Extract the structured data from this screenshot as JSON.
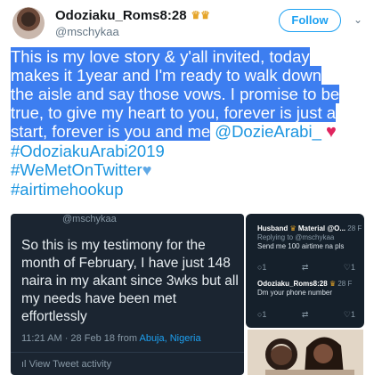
{
  "author": {
    "name": "Odoziaku_Roms8:28",
    "handle": "@mschykaa",
    "badge_icon": "crown-icon"
  },
  "follow_button": {
    "label": "Follow"
  },
  "tweet": {
    "lines": [
      "This is my love story & y'all invited, today",
      "makes it 1year and I'm ready to walk down",
      "the aisle and say those vows. I promise to be",
      "true, to give my heart to you, forever is just a",
      "start, forever is you and me"
    ],
    "mention": "@DozieArabi_",
    "hashtags": [
      "#OdoziakuArabi2019",
      "#WeMetOnTwitter",
      "#airtimehookup"
    ],
    "highlight_color": "#3d7ef0",
    "link_color": "#1b95e0"
  },
  "embedded_tweet": {
    "handle": "@mschykaa",
    "body": "So this is my testimony for the month of February, I have just 148 naira in my akant since 3wks but all my needs have been met effortlessly",
    "time": "11:21 AM · 28 Feb 18 from",
    "location": "Abuja, Nigeria",
    "activity": "View Tweet activity"
  },
  "replies": [
    {
      "name": "Husband",
      "name_suffix": "Material @O...",
      "date": "28 F",
      "replying": "Replying to @mschykaa",
      "text": "Send me 100 airtime na pls"
    },
    {
      "name": "Odoziaku_Roms8:28",
      "name_suffix": "",
      "date": "28 F",
      "replying": "",
      "text": "Dm your phone number"
    }
  ]
}
